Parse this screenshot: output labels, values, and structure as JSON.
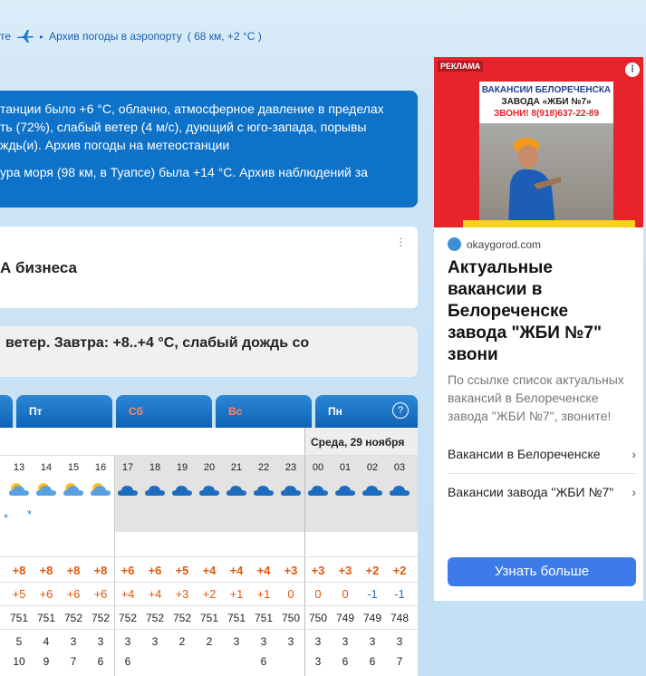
{
  "toplinks": {
    "cut_text": "те",
    "archive_link": "Архив погоды в аэропорту",
    "archive_info": "( 68 км, +2 °C )"
  },
  "info": {
    "lines": [
      "танции было +6 °C, облачно, атмосферное давление в пределах",
      "ть (72%), слабый ветер (4 м/с), дующий с юго-запада, порывы",
      "ждь(и). Архив погоды на метеостанции",
      "ура моря (98 км, в Туапсе) была +14 °C. Архив наблюдений за"
    ]
  },
  "business_card": {
    "title": "А бизнеса"
  },
  "summary_card": {
    "title": "ветер. Завтра: +8..+4 °C, слабый дождь со"
  },
  "tabs": [
    {
      "label": "",
      "weekend": false
    },
    {
      "label": "Пт",
      "weekend": false
    },
    {
      "label": "Сб",
      "weekend": true
    },
    {
      "label": "Вс",
      "weekend": true
    },
    {
      "label": "Пн",
      "weekend": false
    }
  ],
  "help_label": "?",
  "date_header": "Среда, 29 ноября",
  "forecast": {
    "hours": [
      "13",
      "14",
      "15",
      "16",
      "17",
      "18",
      "19",
      "20",
      "21",
      "22",
      "23",
      "00",
      "01",
      "02",
      "03"
    ],
    "temp": [
      "+8",
      "+8",
      "+8",
      "+8",
      "+6",
      "+6",
      "+5",
      "+4",
      "+4",
      "+4",
      "+3",
      "+3",
      "+3",
      "+2",
      "+2"
    ],
    "feels": [
      "+5",
      "+6",
      "+6",
      "+6",
      "+4",
      "+4",
      "+3",
      "+2",
      "+1",
      "+1",
      "0",
      "0",
      "0",
      "-1",
      "-1"
    ],
    "pressure": [
      "751",
      "751",
      "752",
      "752",
      "752",
      "752",
      "752",
      "751",
      "751",
      "751",
      "750",
      "750",
      "749",
      "749",
      "748"
    ],
    "wind": [
      "5",
      "4",
      "3",
      "3",
      "3",
      "3",
      "2",
      "2",
      "3",
      "3",
      "3",
      "3",
      "3",
      "3",
      "3"
    ],
    "gusts": [
      "10",
      "9",
      "7",
      "6",
      "6",
      "",
      "",
      "",
      "",
      "6",
      "",
      "3",
      "6",
      "6",
      "7"
    ]
  },
  "ad": {
    "label": "РЕКЛАМА",
    "menu": "⋮",
    "sign_line1": "ВАКАНСИИ БЕЛОРЕЧЕНСКА",
    "sign_line2": "ЗАВОДА «ЖБИ №7»",
    "sign_line3": "ЗВОНИ! 8(918)637-22-89",
    "source": "okaygorod.com",
    "title": "Актуальные вакансии в Белореченске завода \"ЖБИ №7\" звони",
    "text": "По ссылке список актуальных вакансий в Белореченске завода \"ЖБИ №7\", звоните!",
    "link1": "Вакансии в Белореченске",
    "link2": "Вакансии завода \"ЖБИ №7\"",
    "button": "Узнать больше"
  }
}
